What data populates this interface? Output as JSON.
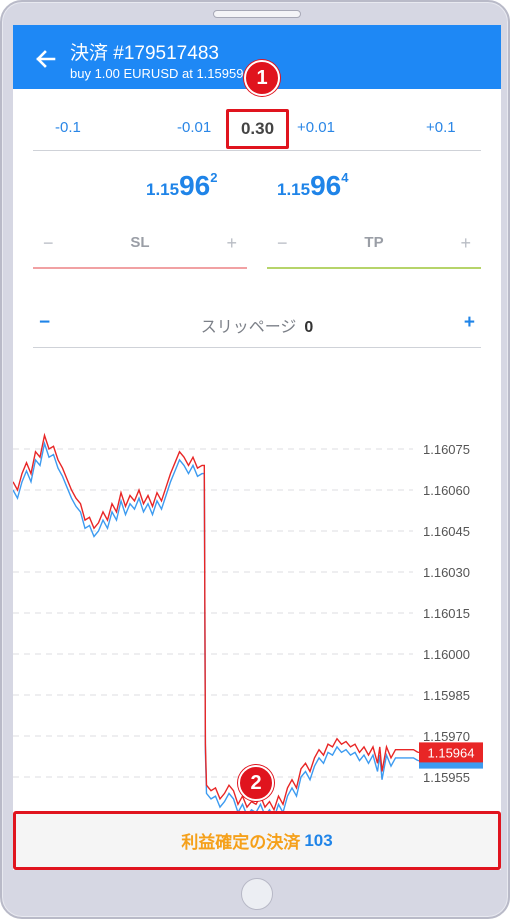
{
  "header": {
    "title": "決済 #179517483",
    "subtitle": "buy 1.00 EURUSD at 1.15959"
  },
  "volume": {
    "dec_large": "-0.1",
    "dec_small": "-0.01",
    "value": "0.30",
    "inc_small": "+0.01",
    "inc_large": "+0.1"
  },
  "prices": {
    "bid": {
      "prefix": "1.15",
      "big": "96",
      "sup": "2"
    },
    "ask": {
      "prefix": "1.15",
      "big": "96",
      "sup": "4"
    }
  },
  "sl": {
    "minus": "−",
    "label": "SL",
    "plus": "+"
  },
  "tp": {
    "minus": "−",
    "label": "TP",
    "plus": "+"
  },
  "slippage": {
    "minus": "−",
    "label": "スリッページ",
    "value": "0",
    "plus": "+"
  },
  "chart_data": {
    "type": "line",
    "y_ticks": [
      "1.16075",
      "1.16060",
      "1.16045",
      "1.16030",
      "1.16015",
      "1.16000",
      "1.15985",
      "1.15970",
      "1.15955"
    ],
    "ylim": [
      1.15945,
      1.16085
    ],
    "current_price_label": "1.15964",
    "grid": true,
    "colors": {
      "bid": "#e82626",
      "ask": "#3d9bf0"
    },
    "bid": [
      [
        0,
        1.16063
      ],
      [
        2,
        1.1606
      ],
      [
        4,
        1.16066
      ],
      [
        6,
        1.1607
      ],
      [
        8,
        1.16066
      ],
      [
        10,
        1.16074
      ],
      [
        12,
        1.16072
      ],
      [
        14,
        1.1608
      ],
      [
        16,
        1.16075
      ],
      [
        18,
        1.16076
      ],
      [
        20,
        1.16071
      ],
      [
        22,
        1.16068
      ],
      [
        24,
        1.16064
      ],
      [
        26,
        1.1606
      ],
      [
        28,
        1.16057
      ],
      [
        30,
        1.16055
      ],
      [
        32,
        1.16049
      ],
      [
        34,
        1.1605
      ],
      [
        36,
        1.16046
      ],
      [
        38,
        1.16048
      ],
      [
        40,
        1.16052
      ],
      [
        42,
        1.16049
      ],
      [
        44,
        1.16055
      ],
      [
        46,
        1.16052
      ],
      [
        48,
        1.16059
      ],
      [
        50,
        1.16054
      ],
      [
        52,
        1.16058
      ],
      [
        54,
        1.16056
      ],
      [
        56,
        1.1606
      ],
      [
        58,
        1.16055
      ],
      [
        60,
        1.16058
      ],
      [
        62,
        1.16054
      ],
      [
        64,
        1.16059
      ],
      [
        66,
        1.16056
      ],
      [
        68,
        1.16061
      ],
      [
        70,
        1.16066
      ],
      [
        72,
        1.1607
      ],
      [
        74,
        1.16074
      ],
      [
        76,
        1.16072
      ],
      [
        78,
        1.16069
      ],
      [
        80,
        1.16072
      ],
      [
        82,
        1.16068
      ],
      [
        84,
        1.16069
      ],
      [
        85,
        1.16069
      ],
      [
        85.5,
        1.15967
      ],
      [
        86,
        1.15952
      ],
      [
        88,
        1.1595
      ],
      [
        90,
        1.15951
      ],
      [
        92,
        1.15947
      ],
      [
        94,
        1.15949
      ],
      [
        96,
        1.15952
      ],
      [
        98,
        1.1595
      ],
      [
        100,
        1.15945
      ],
      [
        102,
        1.15948
      ],
      [
        104,
        1.15944
      ],
      [
        106,
        1.15946
      ],
      [
        108,
        1.15945
      ],
      [
        110,
        1.15948
      ],
      [
        112,
        1.15944
      ],
      [
        114,
        1.15946
      ],
      [
        116,
        1.15943
      ],
      [
        118,
        1.15948
      ],
      [
        120,
        1.15945
      ],
      [
        122,
        1.15951
      ],
      [
        124,
        1.15954
      ],
      [
        126,
        1.15951
      ],
      [
        128,
        1.15958
      ],
      [
        130,
        1.1596
      ],
      [
        132,
        1.15957
      ],
      [
        134,
        1.15962
      ],
      [
        136,
        1.15965
      ],
      [
        138,
        1.15963
      ],
      [
        140,
        1.15967
      ],
      [
        142,
        1.15966
      ],
      [
        144,
        1.15969
      ],
      [
        146,
        1.15967
      ],
      [
        148,
        1.15968
      ],
      [
        150,
        1.15966
      ],
      [
        152,
        1.15967
      ],
      [
        154,
        1.15964
      ],
      [
        156,
        1.15966
      ],
      [
        158,
        1.15963
      ],
      [
        160,
        1.15966
      ],
      [
        162,
        1.1596
      ],
      [
        163,
        1.15966
      ],
      [
        164,
        1.15957
      ],
      [
        166,
        1.15966
      ],
      [
        168,
        1.15962
      ],
      [
        170,
        1.15965
      ],
      [
        172,
        1.15965
      ],
      [
        174,
        1.15965
      ],
      [
        176,
        1.15965
      ],
      [
        178,
        1.15965
      ],
      [
        180,
        1.15964
      ]
    ],
    "ask": [
      [
        0,
        1.1606
      ],
      [
        2,
        1.16057
      ],
      [
        4,
        1.16063
      ],
      [
        6,
        1.16067
      ],
      [
        8,
        1.16063
      ],
      [
        10,
        1.16071
      ],
      [
        12,
        1.16069
      ],
      [
        14,
        1.16077
      ],
      [
        16,
        1.16072
      ],
      [
        18,
        1.16073
      ],
      [
        20,
        1.16068
      ],
      [
        22,
        1.16065
      ],
      [
        24,
        1.16061
      ],
      [
        26,
        1.16057
      ],
      [
        28,
        1.16054
      ],
      [
        30,
        1.16052
      ],
      [
        32,
        1.16046
      ],
      [
        34,
        1.16047
      ],
      [
        36,
        1.16043
      ],
      [
        38,
        1.16045
      ],
      [
        40,
        1.16049
      ],
      [
        42,
        1.16046
      ],
      [
        44,
        1.16052
      ],
      [
        46,
        1.16049
      ],
      [
        48,
        1.16056
      ],
      [
        50,
        1.16051
      ],
      [
        52,
        1.16055
      ],
      [
        54,
        1.16053
      ],
      [
        56,
        1.16057
      ],
      [
        58,
        1.16052
      ],
      [
        60,
        1.16055
      ],
      [
        62,
        1.16051
      ],
      [
        64,
        1.16056
      ],
      [
        66,
        1.16053
      ],
      [
        68,
        1.16058
      ],
      [
        70,
        1.16063
      ],
      [
        72,
        1.16067
      ],
      [
        74,
        1.16071
      ],
      [
        76,
        1.16069
      ],
      [
        78,
        1.16066
      ],
      [
        80,
        1.16069
      ],
      [
        82,
        1.16065
      ],
      [
        84,
        1.16066
      ],
      [
        85,
        1.16066
      ],
      [
        85.5,
        1.15964
      ],
      [
        86,
        1.15949
      ],
      [
        88,
        1.15947
      ],
      [
        90,
        1.15948
      ],
      [
        92,
        1.15944
      ],
      [
        94,
        1.15946
      ],
      [
        96,
        1.15949
      ],
      [
        98,
        1.15947
      ],
      [
        100,
        1.15942
      ],
      [
        102,
        1.15945
      ],
      [
        104,
        1.15941
      ],
      [
        106,
        1.15943
      ],
      [
        108,
        1.15942
      ],
      [
        110,
        1.15945
      ],
      [
        112,
        1.15941
      ],
      [
        114,
        1.15943
      ],
      [
        116,
        1.1594
      ],
      [
        118,
        1.15945
      ],
      [
        120,
        1.15942
      ],
      [
        122,
        1.15948
      ],
      [
        124,
        1.15951
      ],
      [
        126,
        1.15948
      ],
      [
        128,
        1.15955
      ],
      [
        130,
        1.15957
      ],
      [
        132,
        1.15954
      ],
      [
        134,
        1.15959
      ],
      [
        136,
        1.15962
      ],
      [
        138,
        1.1596
      ],
      [
        140,
        1.15964
      ],
      [
        142,
        1.15963
      ],
      [
        144,
        1.15966
      ],
      [
        146,
        1.15964
      ],
      [
        148,
        1.15965
      ],
      [
        150,
        1.15963
      ],
      [
        152,
        1.15964
      ],
      [
        154,
        1.15961
      ],
      [
        156,
        1.15963
      ],
      [
        158,
        1.1596
      ],
      [
        160,
        1.15963
      ],
      [
        162,
        1.15957
      ],
      [
        163,
        1.15963
      ],
      [
        164,
        1.15954
      ],
      [
        166,
        1.15963
      ],
      [
        168,
        1.15959
      ],
      [
        170,
        1.15962
      ],
      [
        172,
        1.15962
      ],
      [
        174,
        1.15962
      ],
      [
        176,
        1.15962
      ],
      [
        178,
        1.15962
      ],
      [
        180,
        1.15961
      ]
    ]
  },
  "close_button": {
    "label": "利益確定の決済",
    "value": "103"
  },
  "markers": {
    "m1": "1",
    "m2": "2"
  }
}
